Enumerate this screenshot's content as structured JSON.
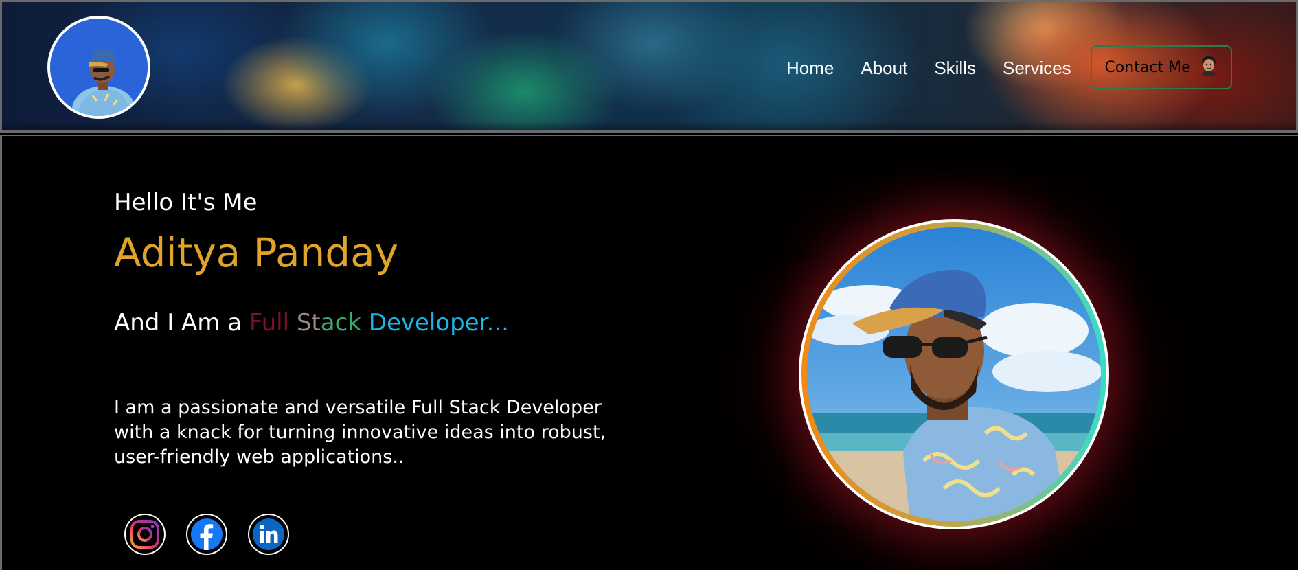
{
  "nav": {
    "links": [
      "Home",
      "About",
      "Skills",
      "Services"
    ],
    "contact_label": "Contact Me",
    "contact_icon": "person-emoji-icon"
  },
  "hero": {
    "greeting": "Hello It's Me",
    "name": "Aditya Panday",
    "role_prefix": "And I Am a",
    "role_full": "Full",
    "role_stack_st": "St",
    "role_stack_rest": "ack",
    "role_developer": "Developer...",
    "description": "I am a passionate and versatile Full Stack Developer with a knack for turning innovative ideas into robust, user-friendly web applications..",
    "socials": [
      "instagram-icon",
      "facebook-icon",
      "linkedin-icon"
    ]
  },
  "colors": {
    "accent_name": "#e0a42a",
    "full": "#7a1228",
    "stack": "#3ea86a",
    "developer": "#1ab8e8",
    "contact_border": "#2f7a4a"
  }
}
